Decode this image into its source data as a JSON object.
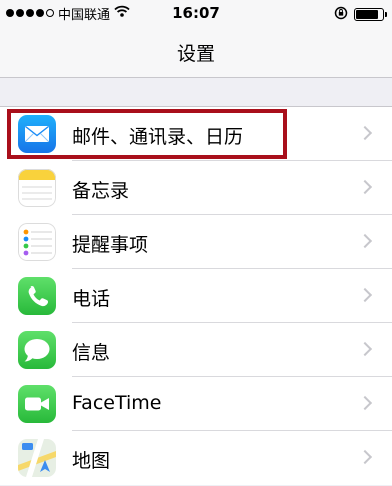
{
  "status_bar": {
    "carrier": "中国联通",
    "time": "16:07",
    "signal_bars": 4,
    "signal_max": 5,
    "battery_level": 0.85
  },
  "nav": {
    "title": "设置"
  },
  "settings": [
    {
      "label": "邮件、通讯录、日历",
      "icon": "mail-icon",
      "color": "#1a8cf7",
      "highlighted": true
    },
    {
      "label": "备忘录",
      "icon": "notes-icon",
      "color": "#f9d23c",
      "highlighted": false
    },
    {
      "label": "提醒事项",
      "icon": "reminders-icon",
      "color": "#ffffff",
      "highlighted": false
    },
    {
      "label": "电话",
      "icon": "phone-icon",
      "color": "#35c94a",
      "highlighted": false
    },
    {
      "label": "信息",
      "icon": "messages-icon",
      "color": "#35c94a",
      "highlighted": false
    },
    {
      "label": "FaceTime",
      "icon": "facetime-icon",
      "color": "#35c94a",
      "highlighted": false
    },
    {
      "label": "地图",
      "icon": "maps-icon",
      "color": "#e7efe4",
      "highlighted": false
    }
  ],
  "highlight_color": "#a90f1b"
}
